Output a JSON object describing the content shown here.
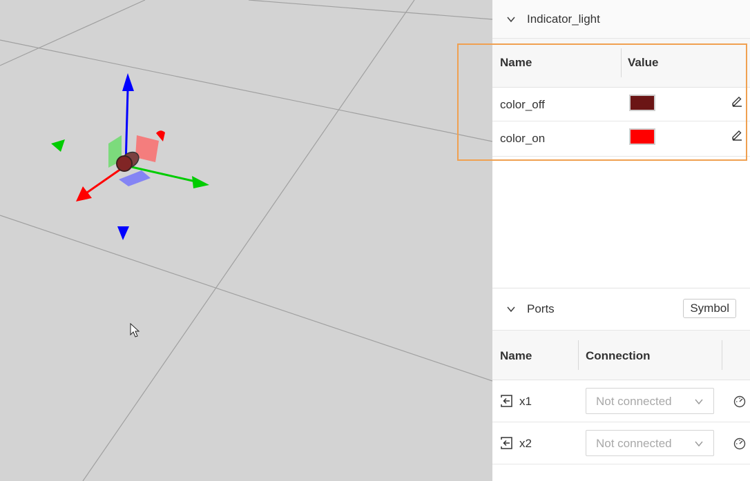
{
  "properties": {
    "title": "Indicator_light",
    "columns": {
      "name": "Name",
      "value": "Value"
    },
    "rows": [
      {
        "name": "color_off",
        "color": "#6b1515"
      },
      {
        "name": "color_on",
        "color": "#ff0000"
      }
    ]
  },
  "ports": {
    "title": "Ports",
    "symbol_label": "Symbol",
    "columns": {
      "name": "Name",
      "connection": "Connection"
    },
    "rows": [
      {
        "name": "x1",
        "connection": "Not connected"
      },
      {
        "name": "x2",
        "connection": "Not connected"
      }
    ]
  },
  "colors": {
    "highlight": "#f0a050",
    "axis_x": "#ff0000",
    "axis_y": "#00cc00",
    "axis_z": "#0000ff"
  },
  "icons": [
    "chevron-down-icon",
    "edit-icon",
    "port-input-icon",
    "gauge-icon",
    "cursor-icon"
  ]
}
